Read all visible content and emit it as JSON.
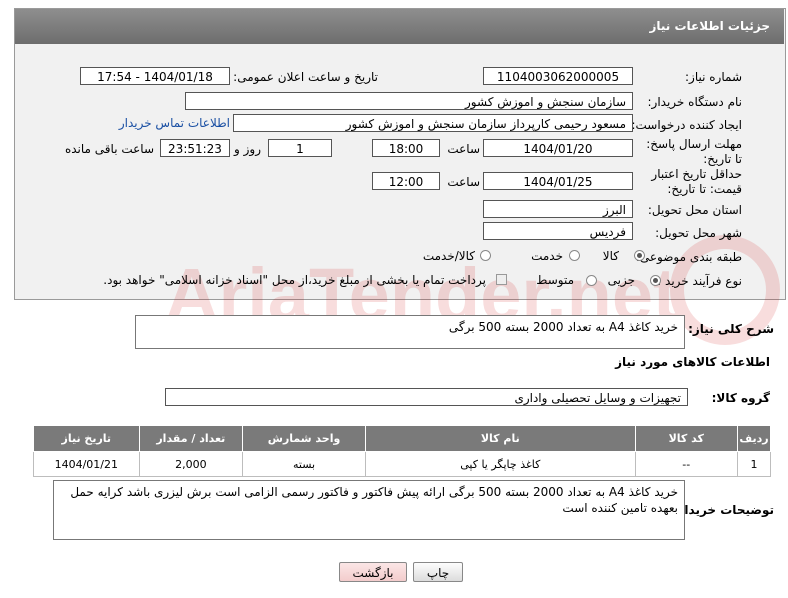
{
  "header": {
    "title": "جزئیات اطلاعات نیاز"
  },
  "fields": {
    "need_number_label": "شماره نیاز:",
    "need_number": "1104003062000005",
    "announce_label": "تاریخ و ساعت اعلان عمومی:",
    "announce_value": "1404/01/18 - 17:54",
    "buyer_org_label": "نام دستگاه خریدار:",
    "buyer_org": "سازمان سنجش و اموزش کشور",
    "creator_label": "ایجاد کننده درخواست:",
    "creator": "مسعود رحیمی کارپرداز سازمان سنجش و اموزش کشور",
    "contact_link": "اطلاعات تماس خریدار",
    "reply_deadline_label": "مهلت ارسال پاسخ: تا تاریخ:",
    "reply_date": "1404/01/20",
    "time_label": "ساعت",
    "reply_time": "18:00",
    "days_value": "1",
    "days_and_label": "روز و",
    "remaining_time": "23:51:23",
    "remaining_label": "ساعت باقی مانده",
    "price_validity_label": "حداقل تاریخ اعتبار قیمت: تا تاریخ:",
    "price_date": "1404/01/25",
    "price_time": "12:00",
    "province_label": "استان محل تحویل:",
    "province": "البرز",
    "city_label": "شهر محل تحویل:",
    "city": "فردیس",
    "category_label": "طبقه بندی موضوعی:",
    "category_options": [
      "کالا",
      "خدمت",
      "کالا/خدمت"
    ],
    "process_label": "نوع فرآیند خرید :",
    "process_options": [
      "جزیی",
      "متوسط"
    ],
    "payment_note": "پرداخت تمام یا بخشی از مبلغ خرید،از محل \"اسناد خزانه اسلامی\" خواهد بود."
  },
  "description": {
    "label": "شرح کلی نیاز:",
    "text": "خرید کاغذ A4 به تعداد 2000 بسته 500 برگی"
  },
  "goods": {
    "section_title": "اطلاعات کالاهای مورد نیاز",
    "group_label": "گروه کالا:",
    "group_value": "تجهیزات و وسایل تحصیلی واداری",
    "columns": [
      "ردیف",
      "کد کالا",
      "نام کالا",
      "واحد شمارش",
      "تعداد / مقدار",
      "تاریخ نیاز"
    ],
    "rows": [
      [
        "1",
        "--",
        "کاغذ چاپگر یا کپی",
        "بسته",
        "2,000",
        "1404/01/21"
      ]
    ]
  },
  "buyer_notes": {
    "label": "توضیحات خریدار:",
    "text": "خرید کاغذ A4 به تعداد 2000 بسته 500 برگی ارائه پیش فاکتور و فاکتور رسمی الزامی است برش لیزری باشد کرایه حمل بعهده تامین کننده است"
  },
  "buttons": {
    "print": "چاپ",
    "back": "بازگشت"
  },
  "watermark": {
    "text": "AriaTender.net"
  },
  "colors": {
    "header": "#7a7a7a",
    "link": "#1a4fa3",
    "back_button": "#f7d7d7"
  }
}
